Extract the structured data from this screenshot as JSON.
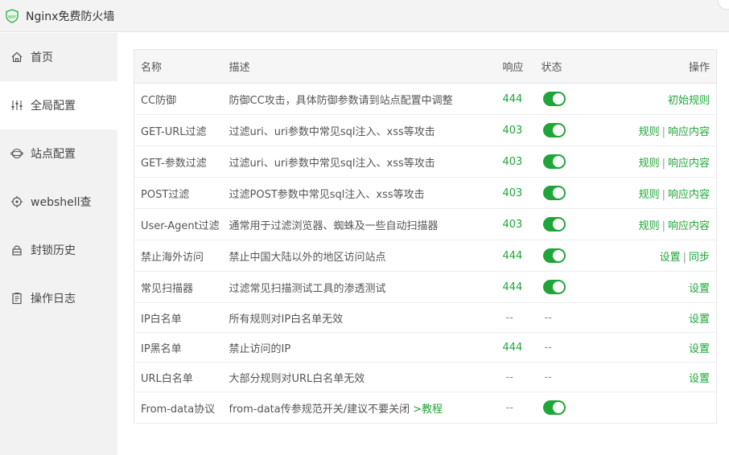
{
  "app": {
    "title": "Nginx免费防火墙",
    "logo_text": "WAF"
  },
  "sidebar": {
    "items": [
      {
        "label": "首页",
        "icon": "home-icon"
      },
      {
        "label": "全局配置",
        "icon": "sliders-icon"
      },
      {
        "label": "站点配置",
        "icon": "globe-icon"
      },
      {
        "label": "webshell查",
        "icon": "target-icon"
      },
      {
        "label": "封锁历史",
        "icon": "lock-icon"
      },
      {
        "label": "操作日志",
        "icon": "clipboard-icon"
      }
    ],
    "active_index": 1
  },
  "table": {
    "headers": {
      "name": "名称",
      "desc": "描述",
      "resp": "响应",
      "status": "状态",
      "ops": "操作"
    },
    "rows": [
      {
        "name": "CC防御",
        "desc": "防御CC攻击，具体防御参数请到站点配置中调整",
        "resp": "444",
        "status": "on",
        "ops": [
          "初始规则"
        ]
      },
      {
        "name": "GET-URL过滤",
        "desc": "过滤uri、uri参数中常见sql注入、xss等攻击",
        "resp": "403",
        "status": "on",
        "ops": [
          "规则",
          "响应内容"
        ]
      },
      {
        "name": "GET-参数过滤",
        "desc": "过滤uri、uri参数中常见sql注入、xss等攻击",
        "resp": "403",
        "status": "on",
        "ops": [
          "规则",
          "响应内容"
        ]
      },
      {
        "name": "POST过滤",
        "desc": "过滤POST参数中常见sql注入、xss等攻击",
        "resp": "403",
        "status": "on",
        "ops": [
          "规则",
          "响应内容"
        ]
      },
      {
        "name": "User-Agent过滤",
        "desc": "通常用于过滤浏览器、蜘蛛及一些自动扫描器",
        "resp": "403",
        "status": "on",
        "ops": [
          "规则",
          "响应内容"
        ]
      },
      {
        "name": "禁止海外访问",
        "desc": "禁止中国大陆以外的地区访问站点",
        "resp": "444",
        "status": "on",
        "ops": [
          "设置",
          "同步"
        ]
      },
      {
        "name": "常见扫描器",
        "desc": "过滤常见扫描测试工具的渗透测试",
        "resp": "444",
        "status": "on",
        "ops": [
          "设置"
        ]
      },
      {
        "name": "IP白名单",
        "desc": "所有规则对IP白名单无效",
        "resp": "--",
        "status": "--",
        "ops": [
          "设置"
        ]
      },
      {
        "name": "IP黑名单",
        "desc": "禁止访问的IP",
        "resp": "444",
        "status": "--",
        "ops": [
          "设置"
        ]
      },
      {
        "name": "URL白名单",
        "desc": "大部分规则对URL白名单无效",
        "resp": "--",
        "status": "--",
        "ops": [
          "设置"
        ]
      },
      {
        "name": "From-data协议",
        "desc": "from-data传参规范开关/建议不要关闭",
        "desc_link": ">教程",
        "resp": "--",
        "status": "on",
        "ops": []
      }
    ]
  },
  "colors": {
    "accent": "#20a53a",
    "sidebar_bg": "#f2f2f2"
  }
}
